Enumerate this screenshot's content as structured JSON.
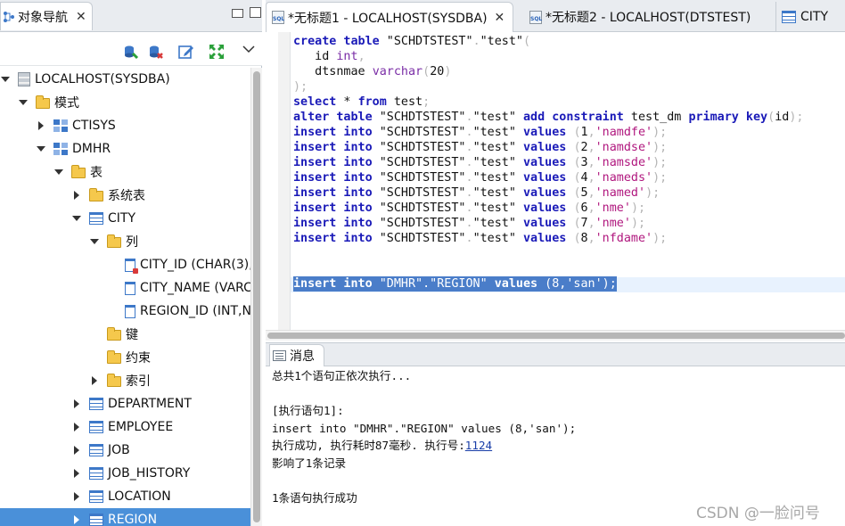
{
  "navigator": {
    "title": "对象导航",
    "close": "✕",
    "tree": [
      {
        "label": "LOCALHOST(SYSDBA)",
        "icon": "server-icon",
        "depth": 0,
        "twisty": "down"
      },
      {
        "label": "模式",
        "icon": "folder-icon",
        "depth": 1,
        "twisty": "down"
      },
      {
        "label": "CTISYS",
        "icon": "schema-icon",
        "depth": 2,
        "twisty": "right"
      },
      {
        "label": "DMHR",
        "icon": "schema-icon",
        "depth": 2,
        "twisty": "down"
      },
      {
        "label": "表",
        "icon": "folder-icon",
        "depth": 3,
        "twisty": "down"
      },
      {
        "label": "系统表",
        "icon": "folder-icon",
        "depth": 4,
        "twisty": "right"
      },
      {
        "label": "CITY",
        "icon": "table-icon",
        "depth": 4,
        "twisty": "down"
      },
      {
        "label": "列",
        "icon": "folder-icon",
        "depth": 5,
        "twisty": "down"
      },
      {
        "label": "CITY_ID (CHAR(3),",
        "icon": "primary-key-column-icon",
        "depth": 6,
        "twisty": "none"
      },
      {
        "label": "CITY_NAME (VARC",
        "icon": "column-icon",
        "depth": 6,
        "twisty": "none"
      },
      {
        "label": "REGION_ID (INT,N",
        "icon": "column-icon",
        "depth": 6,
        "twisty": "none"
      },
      {
        "label": "键",
        "icon": "folder-icon",
        "depth": 5,
        "twisty": "none"
      },
      {
        "label": "约束",
        "icon": "folder-icon",
        "depth": 5,
        "twisty": "none"
      },
      {
        "label": "索引",
        "icon": "folder-icon",
        "depth": 5,
        "twisty": "right"
      },
      {
        "label": "DEPARTMENT",
        "icon": "table-icon",
        "depth": 4,
        "twisty": "right"
      },
      {
        "label": "EMPLOYEE",
        "icon": "table-icon",
        "depth": 4,
        "twisty": "right"
      },
      {
        "label": "JOB",
        "icon": "table-icon",
        "depth": 4,
        "twisty": "right"
      },
      {
        "label": "JOB_HISTORY",
        "icon": "table-icon",
        "depth": 4,
        "twisty": "right"
      },
      {
        "label": "LOCATION",
        "icon": "table-icon",
        "depth": 4,
        "twisty": "right"
      },
      {
        "label": "REGION",
        "icon": "table-icon",
        "depth": 4,
        "twisty": "right",
        "selected": true
      }
    ]
  },
  "editor": {
    "tabs": [
      {
        "label": "*无标题1 - LOCALHOST(SYSDBA)",
        "icon": "sql-file-icon",
        "active": true,
        "close": "✕"
      },
      {
        "label": "*无标题2 - LOCALHOST(DTSTEST)",
        "icon": "sql-file-icon",
        "active": false
      },
      {
        "label": "CITY",
        "icon": "table-icon",
        "active": false
      }
    ],
    "code_lines": [
      [
        [
          "kw",
          "create table"
        ],
        [
          "t",
          " \"SCHDTSTEST\""
        ],
        [
          "pun",
          "."
        ],
        [
          "t",
          "\"test\""
        ],
        [
          "pun",
          "("
        ]
      ],
      [
        [
          "t",
          "   id "
        ],
        [
          "ty",
          "int"
        ],
        [
          "pun",
          ","
        ]
      ],
      [
        [
          "t",
          "   dtsnmae "
        ],
        [
          "ty",
          "varchar"
        ],
        [
          "pun",
          "("
        ],
        [
          "t",
          "20"
        ],
        [
          "pun",
          ")"
        ]
      ],
      [
        [
          "pun",
          ");"
        ]
      ],
      [
        [
          "kw",
          "select"
        ],
        [
          "t",
          " * "
        ],
        [
          "kw",
          "from"
        ],
        [
          "t",
          " test"
        ],
        [
          "pun",
          ";"
        ]
      ],
      [
        [
          "kw",
          "alter table"
        ],
        [
          "t",
          " \"SCHDTSTEST\""
        ],
        [
          "pun",
          "."
        ],
        [
          "t",
          "\"test\" "
        ],
        [
          "kw",
          "add constraint"
        ],
        [
          "t",
          " test_dm "
        ],
        [
          "kw",
          "primary key"
        ],
        [
          "pun",
          "("
        ],
        [
          "t",
          "id"
        ],
        [
          "pun",
          ");"
        ]
      ],
      [
        [
          "kw",
          "insert into"
        ],
        [
          "t",
          " \"SCHDTSTEST\""
        ],
        [
          "pun",
          "."
        ],
        [
          "t",
          "\"test\" "
        ],
        [
          "kw",
          "values"
        ],
        [
          "t",
          " "
        ],
        [
          "pun",
          "("
        ],
        [
          "t",
          "1"
        ],
        [
          "pun",
          ","
        ],
        [
          "str",
          "'namdfe'"
        ],
        [
          "pun",
          ");"
        ]
      ],
      [
        [
          "kw",
          "insert into"
        ],
        [
          "t",
          " \"SCHDTSTEST\""
        ],
        [
          "pun",
          "."
        ],
        [
          "t",
          "\"test\" "
        ],
        [
          "kw",
          "values"
        ],
        [
          "t",
          " "
        ],
        [
          "pun",
          "("
        ],
        [
          "t",
          "2"
        ],
        [
          "pun",
          ","
        ],
        [
          "str",
          "'namdse'"
        ],
        [
          "pun",
          ");"
        ]
      ],
      [
        [
          "kw",
          "insert into"
        ],
        [
          "t",
          " \"SCHDTSTEST\""
        ],
        [
          "pun",
          "."
        ],
        [
          "t",
          "\"test\" "
        ],
        [
          "kw",
          "values"
        ],
        [
          "t",
          " "
        ],
        [
          "pun",
          "("
        ],
        [
          "t",
          "3"
        ],
        [
          "pun",
          ","
        ],
        [
          "str",
          "'namsde'"
        ],
        [
          "pun",
          ");"
        ]
      ],
      [
        [
          "kw",
          "insert into"
        ],
        [
          "t",
          " \"SCHDTSTEST\""
        ],
        [
          "pun",
          "."
        ],
        [
          "t",
          "\"test\" "
        ],
        [
          "kw",
          "values"
        ],
        [
          "t",
          " "
        ],
        [
          "pun",
          "("
        ],
        [
          "t",
          "4"
        ],
        [
          "pun",
          ","
        ],
        [
          "str",
          "'nameds'"
        ],
        [
          "pun",
          ");"
        ]
      ],
      [
        [
          "kw",
          "insert into"
        ],
        [
          "t",
          " \"SCHDTSTEST\""
        ],
        [
          "pun",
          "."
        ],
        [
          "t",
          "\"test\" "
        ],
        [
          "kw",
          "values"
        ],
        [
          "t",
          " "
        ],
        [
          "pun",
          "("
        ],
        [
          "t",
          "5"
        ],
        [
          "pun",
          ","
        ],
        [
          "str",
          "'named'"
        ],
        [
          "pun",
          ");"
        ]
      ],
      [
        [
          "kw",
          "insert into"
        ],
        [
          "t",
          " \"SCHDTSTEST\""
        ],
        [
          "pun",
          "."
        ],
        [
          "t",
          "\"test\" "
        ],
        [
          "kw",
          "values"
        ],
        [
          "t",
          " "
        ],
        [
          "pun",
          "("
        ],
        [
          "t",
          "6"
        ],
        [
          "pun",
          ","
        ],
        [
          "str",
          "'nme'"
        ],
        [
          "pun",
          ");"
        ]
      ],
      [
        [
          "kw",
          "insert into"
        ],
        [
          "t",
          " \"SCHDTSTEST\""
        ],
        [
          "pun",
          "."
        ],
        [
          "t",
          "\"test\" "
        ],
        [
          "kw",
          "values"
        ],
        [
          "t",
          " "
        ],
        [
          "pun",
          "("
        ],
        [
          "t",
          "7"
        ],
        [
          "pun",
          ","
        ],
        [
          "str",
          "'nme'"
        ],
        [
          "pun",
          ");"
        ]
      ],
      [
        [
          "kw",
          "insert into"
        ],
        [
          "t",
          " \"SCHDTSTEST\""
        ],
        [
          "pun",
          "."
        ],
        [
          "t",
          "\"test\" "
        ],
        [
          "kw",
          "values"
        ],
        [
          "t",
          " "
        ],
        [
          "pun",
          "("
        ],
        [
          "t",
          "8"
        ],
        [
          "pun",
          ","
        ],
        [
          "str",
          "'nfdame'"
        ],
        [
          "pun",
          ");"
        ]
      ],
      [],
      [],
      [
        [
          "kw",
          "insert into"
        ],
        [
          "t",
          " \"DMHR\".\"REGION\" "
        ],
        [
          "kw",
          "values"
        ],
        [
          "t",
          " (8,'san');"
        ]
      ]
    ],
    "selected_line_index": 16
  },
  "messages": {
    "title": "消息",
    "lines": [
      "总共1个语句正依次执行...",
      "",
      "[执行语句1]:",
      "insert into \"DMHR\".\"REGION\" values (8,'san');",
      "执行成功, 执行耗时87毫秒. 执行号:",
      "影响了1条记录",
      "",
      "1条语句执行成功"
    ],
    "execution_number": "1124"
  },
  "watermark": "CSDN @一脸问号"
}
